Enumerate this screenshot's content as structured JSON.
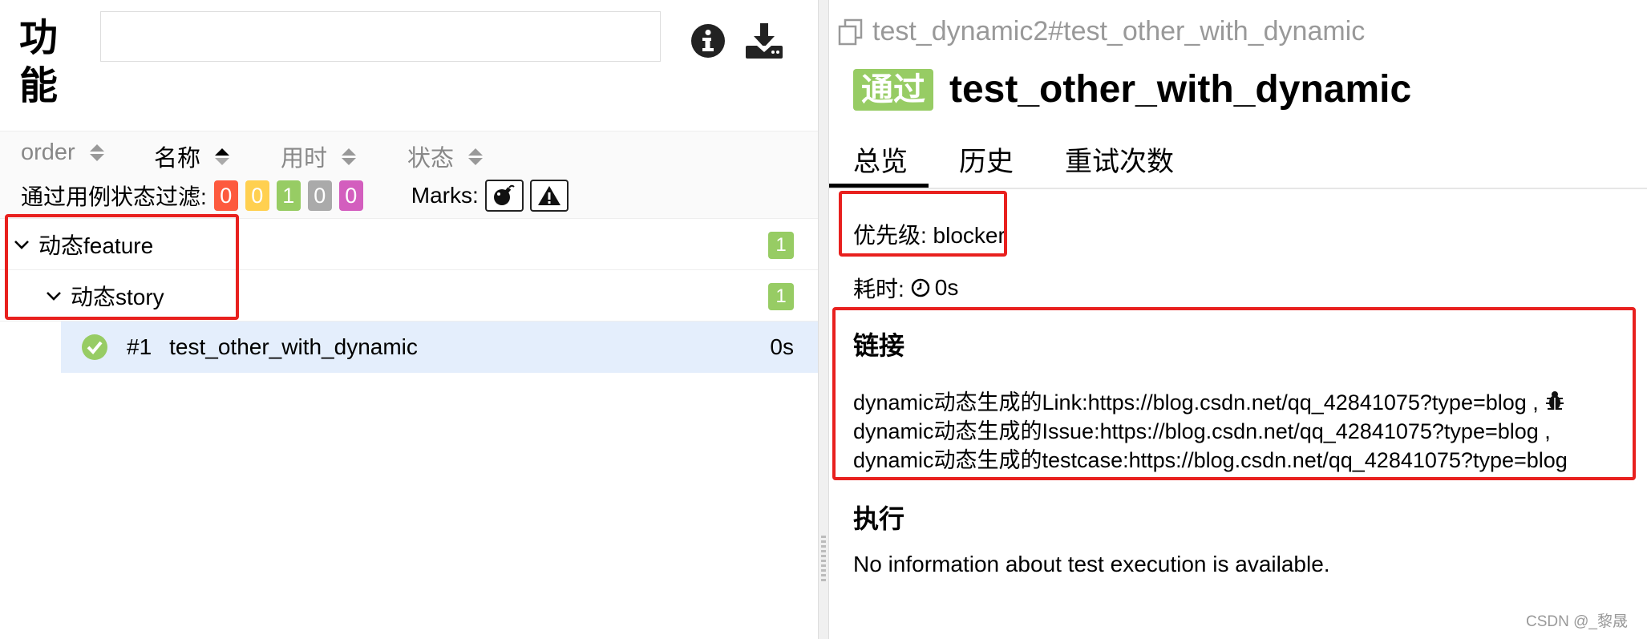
{
  "left": {
    "feature_title": "功能",
    "search": {
      "value": "",
      "placeholder": ""
    },
    "sort": [
      "order",
      "名称",
      "用时",
      "状态"
    ],
    "filter_label": "通过用例状态过滤:",
    "status_chips": [
      {
        "value": "0",
        "color": "#fd5a3e"
      },
      {
        "value": "0",
        "color": "#ffd050"
      },
      {
        "value": "1",
        "color": "#97cc64"
      },
      {
        "value": "0",
        "color": "#aaaaaa"
      },
      {
        "value": "0",
        "color": "#d35ebe"
      }
    ],
    "marks_label": "Marks:",
    "tree": {
      "feature": {
        "label": "动态feature",
        "count": "1"
      },
      "story": {
        "label": "动态story",
        "count": "1"
      },
      "leaf": {
        "num": "#1",
        "name": "test_other_with_dynamic",
        "duration": "0s"
      }
    }
  },
  "right": {
    "breadcrumb": "test_dynamic2#test_other_with_dynamic",
    "status": "通过",
    "title": "test_other_with_dynamic",
    "tabs": [
      "总览",
      "历史",
      "重试次数"
    ],
    "severity": "优先级: blocker",
    "duration_label": "耗时:",
    "duration_value": "0s",
    "links_title": "链接",
    "links": [
      "dynamic动态生成的Link:https://blog.csdn.net/qq_42841075?type=blog ,",
      "dynamic动态生成的Issue:https://blog.csdn.net/qq_42841075?type=blog ,",
      "dynamic动态生成的testcase:https://blog.csdn.net/qq_42841075?type=blog"
    ],
    "execution_title": "执行",
    "execution_text": "No information about test execution is available."
  },
  "watermark": "CSDN @_黎晟",
  "colors": {
    "passed": "#97cc64",
    "highlight_box": "#e8201e",
    "selected_row": "#e4eefc"
  }
}
